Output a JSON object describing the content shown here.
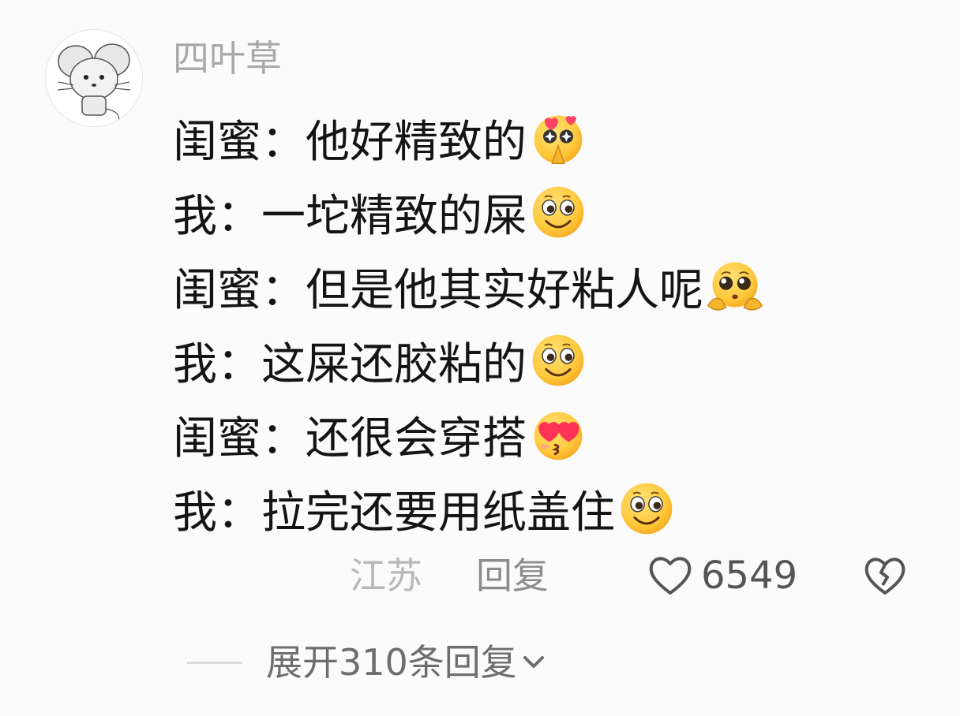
{
  "comment": {
    "username": "四叶草",
    "lines": [
      {
        "text": "闺蜜：他好精致的",
        "emoji": "star-eyes-praying-face-icon"
      },
      {
        "text": "我：一坨精致的屎",
        "emoji": "grinning-face-icon"
      },
      {
        "text": "闺蜜：但是他其实好粘人呢",
        "emoji": "pleading-face-icon"
      },
      {
        "text": "我：这屎还胶粘的",
        "emoji": "grinning-face-icon"
      },
      {
        "text": "闺蜜：还很会穿搭",
        "emoji": "heart-eyes-kiss-face-icon"
      },
      {
        "text": "我：拉完还要用纸盖住",
        "emoji": "grinning-face-icon"
      }
    ],
    "footer": {
      "location": "江苏",
      "reply_label": "回复",
      "like_count": "6549"
    },
    "expand": {
      "label": "展开310条回复"
    }
  },
  "colors": {
    "background": "#fbfbfb",
    "username": "#a9a9a9",
    "text": "#141414",
    "location": "#b8b8b8",
    "reply": "#8d8d8d",
    "emoji_yellow": "#ffc83a"
  }
}
